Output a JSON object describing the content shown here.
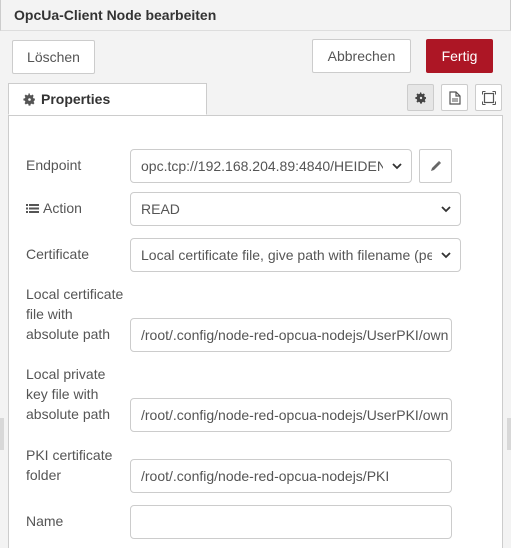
{
  "header": {
    "title": "OpcUa-Client Node bearbeiten"
  },
  "toolbar": {
    "delete_label": "Löschen",
    "cancel_label": "Abbrechen",
    "done_label": "Fertig"
  },
  "colors": {
    "primary": "#ad1625",
    "border": "#cccccc",
    "text": "#555555"
  },
  "tabs": [
    {
      "label": "Properties",
      "icon": "gear-icon"
    }
  ],
  "tab_icons": [
    "gear-icon",
    "document-icon",
    "frame-icon"
  ],
  "form": {
    "endpoint": {
      "label": "Endpoint",
      "value": "opc.tcp://192.168.204.89:4840/HEIDEN",
      "edit_icon": "pencil-icon"
    },
    "action": {
      "label": "Action",
      "icon": "list-icon",
      "value": "READ"
    },
    "certificate": {
      "label": "Certificate",
      "value": "Local certificate file, give path with filename (per"
    },
    "local_cert": {
      "label_lines": [
        "Local certificate",
        "file with",
        "absolute path"
      ],
      "value": "/root/.config/node-red-opcua-nodejs/UserPKI/own"
    },
    "private_key": {
      "label_lines": [
        "Local private",
        "key file with",
        "absolute path"
      ],
      "value": "/root/.config/node-red-opcua-nodejs/UserPKI/own"
    },
    "pki_folder": {
      "label_lines": [
        "PKI certificate",
        "folder"
      ],
      "value": "/root/.config/node-red-opcua-nodejs/PKI"
    },
    "name": {
      "label": "Name",
      "value": ""
    }
  }
}
